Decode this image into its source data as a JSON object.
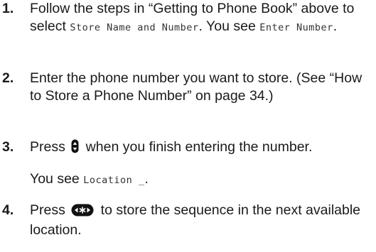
{
  "steps": [
    {
      "number": "1.",
      "text_before": "Follow the steps in “Getting to Phone Book” above to select ",
      "display_1": "Store Name and Number",
      "text_middle": ". You see ",
      "display_2": "Enter Number",
      "text_after": "."
    },
    {
      "number": "2.",
      "text": "Enter the phone number you want to store. (See “How to Store a Phone Number” on page 34.)"
    },
    {
      "number": "3.",
      "text_before": "Press ",
      "icon": "navigation-key-icon",
      "text_after": " when you finish entering the number.",
      "sub_before": "You see ",
      "sub_display": "Location _",
      "sub_after": "."
    },
    {
      "number": "4.",
      "text_before": "Press ",
      "icon": "star-key-icon",
      "text_after": " to store the sequence in the next available location."
    }
  ]
}
